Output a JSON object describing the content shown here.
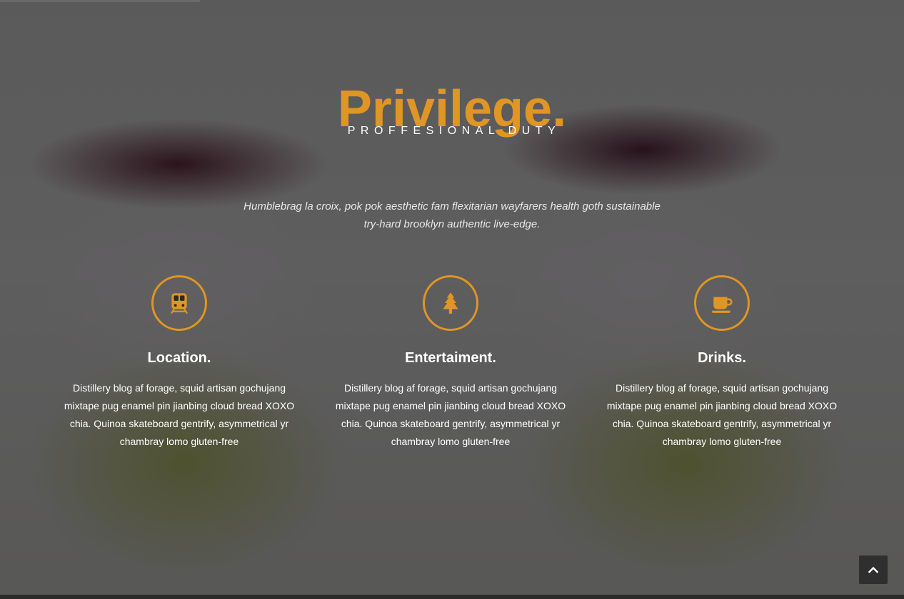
{
  "hero": {
    "title": "Privilege.",
    "subtitle": "PROFFESIONAL DUTY",
    "lead": "Humblebrag la croix, pok pok aesthetic fam flexitarian wayfarers health goth sustainable try-hard brooklyn authentic live-edge."
  },
  "features": [
    {
      "icon": "train-icon",
      "title": "Location.",
      "text": "Distillery blog af forage, squid artisan gochujang mixtape pug enamel pin jianbing cloud bread XOXO chia. Quinoa skateboard gentrify, asymmetrical yr chambray lomo gluten-free"
    },
    {
      "icon": "tree-icon",
      "title": "Entertaiment.",
      "text": "Distillery blog af forage, squid artisan gochujang mixtape pug enamel pin jianbing cloud bread XOXO chia. Quinoa skateboard gentrify, asymmetrical yr chambray lomo gluten-free"
    },
    {
      "icon": "coffee-cup-icon",
      "title": "Drinks.",
      "text": "Distillery blog af forage, squid artisan gochujang mixtape pug enamel pin jianbing cloud bread XOXO chia. Quinoa skateboard gentrify, asymmetrical yr chambray lomo gluten-free"
    }
  ],
  "scroll_top": {
    "icon": "chevron-up-icon"
  },
  "colors": {
    "accent": "#e09624",
    "text": "#ffffff",
    "button_bg": "#2f2f2f"
  }
}
